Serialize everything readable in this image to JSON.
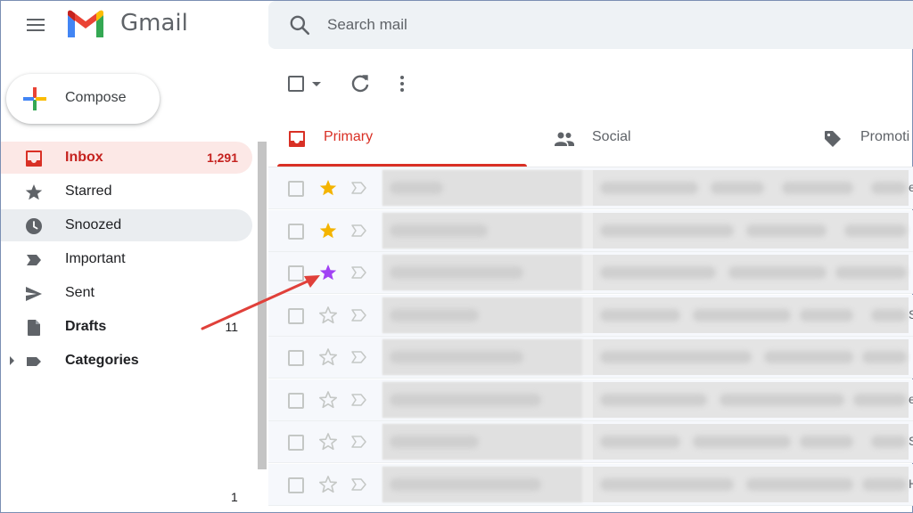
{
  "header": {
    "app_name": "Gmail",
    "search_placeholder": "Search mail"
  },
  "compose": {
    "label": "Compose"
  },
  "sidebar": {
    "items": [
      {
        "label": "Inbox",
        "count": "1,291",
        "icon": "inbox-icon",
        "state": "active"
      },
      {
        "label": "Starred",
        "count": "",
        "icon": "star-icon",
        "state": ""
      },
      {
        "label": "Snoozed",
        "count": "",
        "icon": "clock-icon",
        "state": "hover"
      },
      {
        "label": "Important",
        "count": "",
        "icon": "label-important-icon",
        "state": ""
      },
      {
        "label": "Sent",
        "count": "",
        "icon": "send-icon",
        "state": ""
      },
      {
        "label": "Drafts",
        "count": "11",
        "icon": "draft-icon",
        "state": "bold"
      },
      {
        "label": "Categories",
        "count": "",
        "icon": "label-icon",
        "state": "bold"
      }
    ],
    "footer_count": "1"
  },
  "tabs": [
    {
      "label": "Primary",
      "icon": "inbox-icon",
      "selected": true
    },
    {
      "label": "Social",
      "icon": "people-icon",
      "selected": false
    },
    {
      "label": "Promoti",
      "icon": "tag-icon",
      "selected": false
    }
  ],
  "emails": [
    {
      "star": "yellow",
      "edge": "e"
    },
    {
      "star": "yellow",
      "edge": ""
    },
    {
      "star": "purple",
      "edge": ""
    },
    {
      "star": "none",
      "edge": "S"
    },
    {
      "star": "none",
      "edge": ""
    },
    {
      "star": "none",
      "edge": "e"
    },
    {
      "star": "none",
      "edge": "S"
    },
    {
      "star": "none",
      "edge": "H"
    }
  ],
  "colors": {
    "accent_red": "#d93025",
    "active_bg": "#fce8e6",
    "star_yellow": "#f4b400",
    "star_purple": "#a142f4"
  }
}
